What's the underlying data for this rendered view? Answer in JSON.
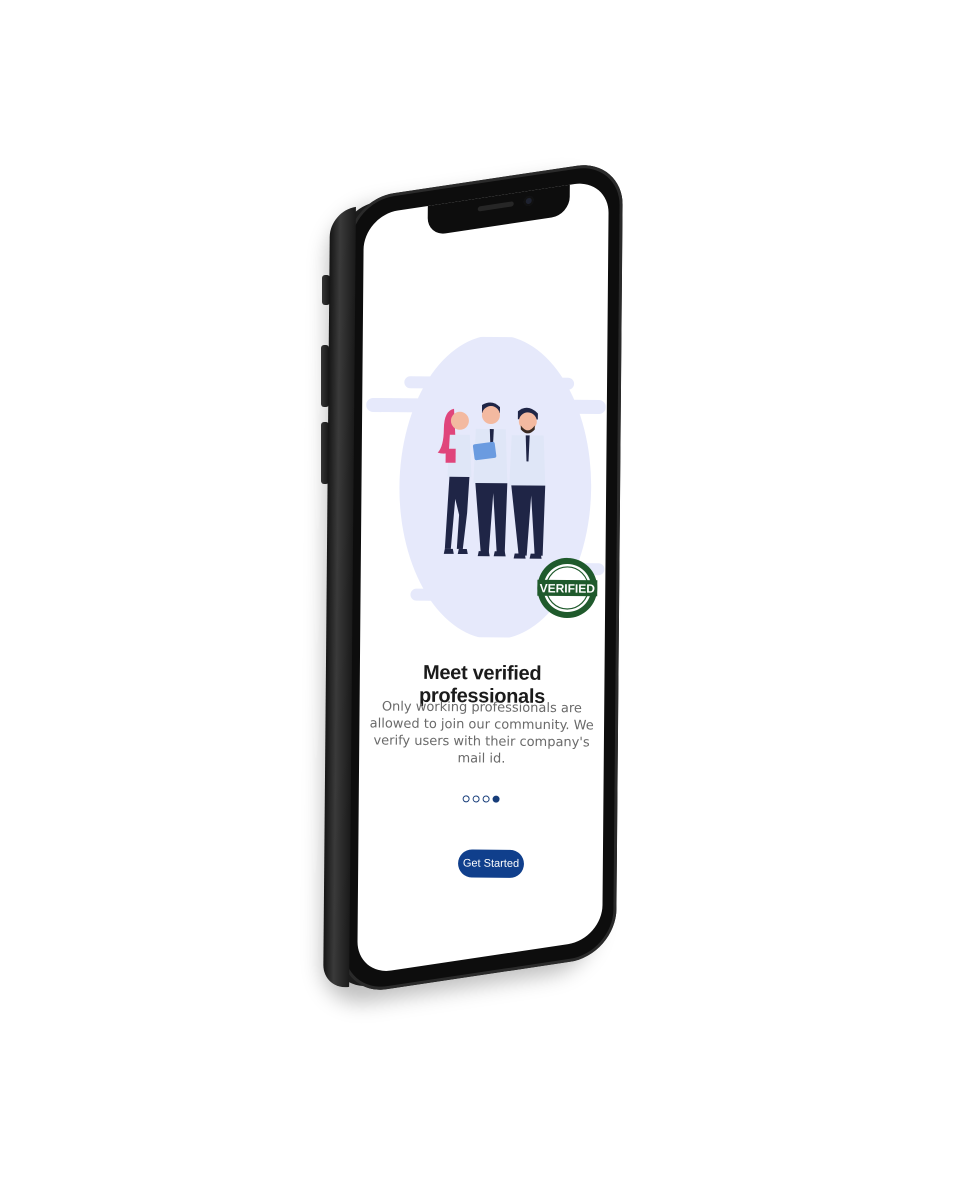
{
  "onboarding": {
    "title": "Meet verified professionals",
    "description": "Only working professionals are allowed to join our community. We verify users with their company's mail id.",
    "cta_label": "Get Started",
    "stamp_text": "VERIFIED",
    "pager": {
      "total": 4,
      "active_index": 3
    }
  },
  "colors": {
    "primary": "#103f8c",
    "illustration_bg": "#e6e9fb",
    "stamp_green": "#1f5a2c",
    "title": "#1b1b1b",
    "body_text": "#6a6a6a"
  },
  "icons": {
    "illustration": "three-professionals-illustration",
    "badge": "verified-stamp-icon"
  }
}
